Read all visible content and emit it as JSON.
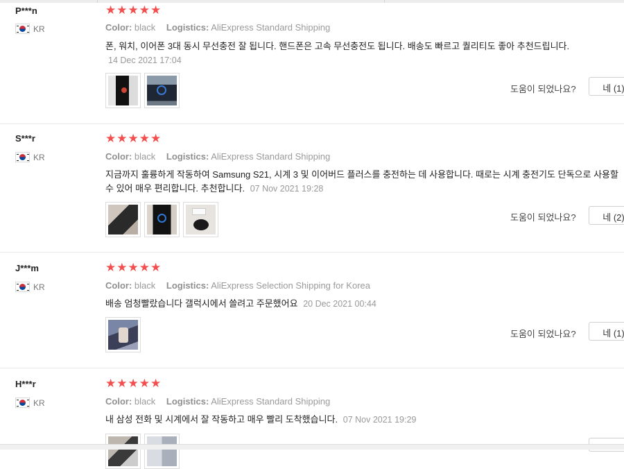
{
  "reviews": [
    {
      "user": "P***n",
      "country": "KR",
      "stars": "★★★★★",
      "color_label": "Color:",
      "color_value": "black",
      "logistics_label": "Logistics:",
      "logistics_value": "AliExpress Standard Shipping",
      "text": "폰, 워치, 이어폰 3대 동시 무선충전 잘 됩니다. 핸드폰은 고속 무선충전도 됩니다. 배송도 빠르고 퀄리티도 좋아 추천드립니다.",
      "date": "14 Dec 2021 17:04",
      "helpful_label": "도움이 되었나요?",
      "yes_button": "네 (1)"
    },
    {
      "user": "S***r",
      "country": "KR",
      "stars": "★★★★★",
      "color_label": "Color:",
      "color_value": "black",
      "logistics_label": "Logistics:",
      "logistics_value": "AliExpress Standard Shipping",
      "text": "지금까지 훌륭하게 작동하여 Samsung S21, 시계 3 및 이어버드 플러스를 충전하는 데 사용합니다. 때로는 시계 충전기도 단독으로 사용할 수 있어 매우 편리합니다. 추천합니다.",
      "date": "07 Nov 2021 19:28",
      "helpful_label": "도움이 되었나요?",
      "yes_button": "네 (2)"
    },
    {
      "user": "J***m",
      "country": "KR",
      "stars": "★★★★★",
      "color_label": "Color:",
      "color_value": "black",
      "logistics_label": "Logistics:",
      "logistics_value": "AliExpress Selection Shipping for Korea",
      "text": "배송 엄청빨랐습니다 갤럭시에서 쓸려고 주문했어요",
      "date": "20 Dec 2021 00:44",
      "helpful_label": "도움이 되었나요?",
      "yes_button": "네 (1)"
    },
    {
      "user": "H***r",
      "country": "KR",
      "stars": "★★★★★",
      "color_label": "Color:",
      "color_value": "black",
      "logistics_label": "Logistics:",
      "logistics_value": "AliExpress Standard Shipping",
      "text": "내 삼성 전화 및 시계에서 잘 작동하고 매우 빨리 도착했습니다.",
      "date": "07 Nov 2021 19:29"
    }
  ],
  "colors": {
    "star": "#f44e4e",
    "meta_text": "#999999",
    "border": "#e8e8e8"
  },
  "icons": {
    "flag": "south-korea-flag-icon",
    "star": "star-icon"
  }
}
